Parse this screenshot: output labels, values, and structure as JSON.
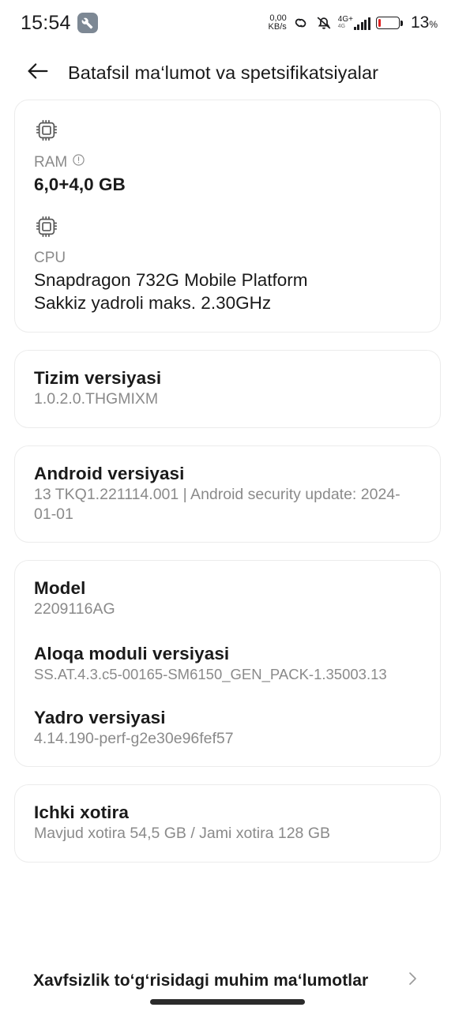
{
  "statusbar": {
    "clock": "15:54",
    "wrench_icon": "wrench-icon",
    "network_speed_value": "0,00",
    "network_speed_unit": "KB/s",
    "link_icon": "link-icon",
    "mute_icon": "bell-muted-icon",
    "network_generation": "4G+",
    "network_generation_secondary": "4G",
    "signal_icon": "signal-bars-icon",
    "battery_icon": "battery-low-icon",
    "battery_percent": "13",
    "battery_percent_unit": "%",
    "battery_level_pct": 13,
    "accent_battery_color": "#e02020"
  },
  "header": {
    "back_icon": "arrow-left-icon",
    "title": "Batafsil ma‘lumot va spetsifikatsiyalar"
  },
  "cards": {
    "hardware": {
      "ram": {
        "icon": "memory-chip-icon",
        "label": "RAM",
        "info_icon": "info-icon",
        "value": "6,0+4,0 GB"
      },
      "cpu": {
        "icon": "cpu-chip-icon",
        "label": "CPU",
        "value_line1": "Snapdragon 732G Mobile Platform",
        "value_line2": "Sakkiz yadroli maks. 2.30GHz"
      }
    },
    "system_version": {
      "title": "Tizim versiyasi",
      "value": "1.0.2.0.THGMIXM"
    },
    "android_version": {
      "title": "Android versiyasi",
      "value": "13 TKQ1.221114.001 | Android security update: 2024-01-01"
    },
    "device": {
      "model": {
        "title": "Model",
        "value": "2209116AG"
      },
      "baseband": {
        "title": "Aloqa moduli versiyasi",
        "value": "SS.AT.4.3.c5-00165-SM6150_GEN_PACK-1.35003.13"
      },
      "kernel": {
        "title": "Yadro versiyasi",
        "value": "4.14.190-perf-g2e30e96fef57"
      }
    },
    "storage": {
      "title": "Ichki xotira",
      "value": "Mavjud xotira  54,5 GB / Jami xotira  128 GB"
    }
  },
  "footer": {
    "label": "Xavfsizlik to‘g‘risidagi muhim ma‘lumotlar",
    "chevron_icon": "chevron-right-icon"
  }
}
